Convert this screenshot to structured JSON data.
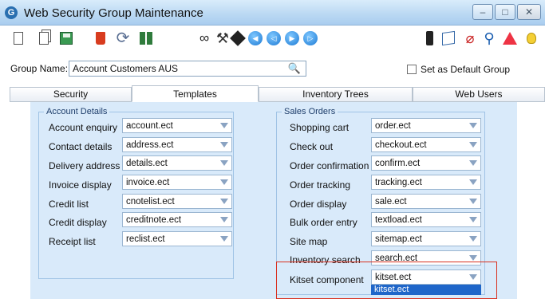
{
  "window": {
    "title": "Web Security Group Maintenance",
    "app_icon_letter": "G"
  },
  "toolbar": {
    "icons": [
      "new-document-icon",
      "copy-document-icon",
      "save-icon",
      "delete-icon",
      "refresh-icon",
      "grid-icon",
      "binoculars-icon",
      "wrench-icon",
      "flash-icon",
      "first-record-icon",
      "previous-record-icon",
      "next-record-icon",
      "last-record-icon",
      "traffic-light-icon",
      "note-icon",
      "paperclip-icon",
      "link-icon",
      "warning-icon",
      "lightbulb-icon"
    ]
  },
  "group": {
    "label": "Group Name:",
    "value": "Account Customers AUS",
    "default_label": "Set as Default Group"
  },
  "tabs": [
    {
      "label": "Security"
    },
    {
      "label": "Templates"
    },
    {
      "label": "Inventory Trees"
    },
    {
      "label": "Web Users"
    }
  ],
  "account_details": {
    "title": "Account Details",
    "rows": [
      {
        "label": "Account enquiry",
        "value": "account.ect"
      },
      {
        "label": "Contact details",
        "value": "address.ect"
      },
      {
        "label": "Delivery address",
        "value": "details.ect"
      },
      {
        "label": "Invoice display",
        "value": "invoice.ect"
      },
      {
        "label": "Credit list",
        "value": "cnotelist.ect"
      },
      {
        "label": "Credit display",
        "value": "creditnote.ect"
      },
      {
        "label": "Receipt list",
        "value": "reclist.ect"
      }
    ]
  },
  "sales_orders": {
    "title": "Sales Orders",
    "rows": [
      {
        "label": "Shopping cart",
        "value": "order.ect"
      },
      {
        "label": "Check out",
        "value": "checkout.ect"
      },
      {
        "label": "Order confirmation",
        "value": "confirm.ect"
      },
      {
        "label": "Order tracking",
        "value": "tracking.ect"
      },
      {
        "label": "Order display",
        "value": "sale.ect"
      },
      {
        "label": "Bulk order entry",
        "value": "textload.ect"
      },
      {
        "label": "Site map",
        "value": "sitemap.ect"
      },
      {
        "label": "Inventory search",
        "value": "search.ect"
      },
      {
        "label": "Kitset component",
        "value": "kitset.ect"
      }
    ],
    "dropdown_selected": "kitset.ect"
  },
  "colors": {
    "highlight_border": "#d9301f",
    "panel_bg": "#d9eafa",
    "selection_bg": "#1f66c9"
  }
}
